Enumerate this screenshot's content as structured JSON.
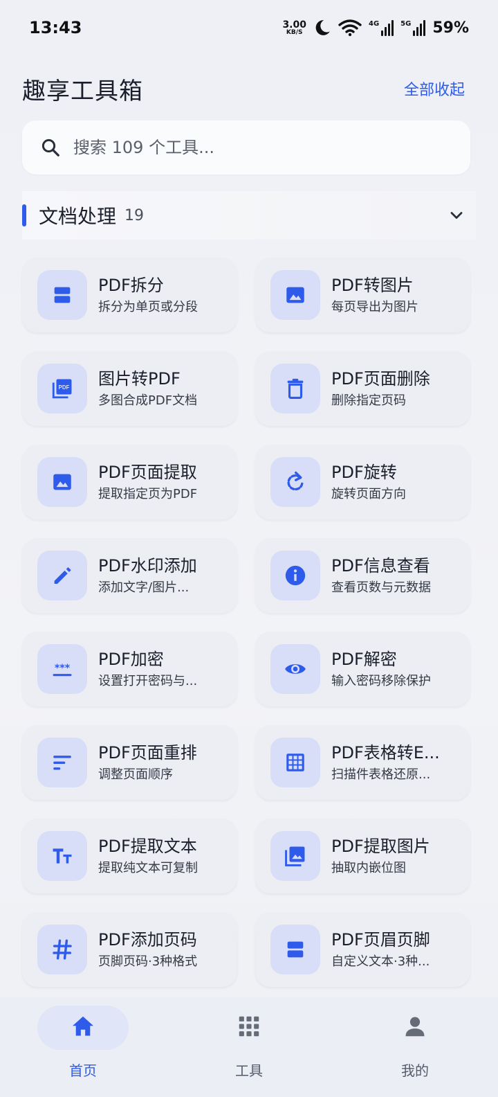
{
  "status_bar": {
    "time": "13:43",
    "speed_value": "3.00",
    "speed_unit": "KB/S",
    "net1": "4G",
    "net2": "5G",
    "battery": "59%"
  },
  "header": {
    "title": "趣享工具箱",
    "collapse_all": "全部收起"
  },
  "search": {
    "placeholder": "搜索 109 个工具..."
  },
  "section": {
    "title": "文档处理",
    "count": "19"
  },
  "colors": {
    "accent": "#2e5bea",
    "icon_bg": "#d8def7",
    "card_bg": "#eceef4"
  },
  "tools": [
    {
      "title": "PDF拆分",
      "subtitle": "拆分为单页或分段",
      "icon": "split-icon"
    },
    {
      "title": "PDF转图片",
      "subtitle": "每页导出为图片",
      "icon": "image-icon"
    },
    {
      "title": "图片转PDF",
      "subtitle": "多图合成PDF文档",
      "icon": "pdf-stack-icon"
    },
    {
      "title": "PDF页面删除",
      "subtitle": "删除指定页码",
      "icon": "trash-icon"
    },
    {
      "title": "PDF页面提取",
      "subtitle": "提取指定页为PDF",
      "icon": "image-icon"
    },
    {
      "title": "PDF旋转",
      "subtitle": "旋转页面方向",
      "icon": "rotate-icon"
    },
    {
      "title": "PDF水印添加",
      "subtitle": "添加文字/图片...",
      "icon": "pencil-icon"
    },
    {
      "title": "PDF信息查看",
      "subtitle": "查看页数与元数据",
      "icon": "info-icon"
    },
    {
      "title": "PDF加密",
      "subtitle": "设置打开密码与...",
      "icon": "password-icon"
    },
    {
      "title": "PDF解密",
      "subtitle": "输入密码移除保护",
      "icon": "eye-icon"
    },
    {
      "title": "PDF页面重排",
      "subtitle": "调整页面顺序",
      "icon": "sort-icon"
    },
    {
      "title": "PDF表格转E...",
      "subtitle": "扫描件表格还原...",
      "icon": "grid-icon"
    },
    {
      "title": "PDF提取文本",
      "subtitle": "提取纯文本可复制",
      "icon": "text-size-icon"
    },
    {
      "title": "PDF提取图片",
      "subtitle": "抽取内嵌位图",
      "icon": "photo-library-icon"
    },
    {
      "title": "PDF添加页码",
      "subtitle": "页脚页码·3种格式",
      "icon": "hash-icon"
    },
    {
      "title": "PDF页眉页脚",
      "subtitle": "自定义文本·3种...",
      "icon": "split-icon"
    }
  ],
  "bottom_nav": [
    {
      "label": "首页",
      "icon": "home-icon",
      "active": true
    },
    {
      "label": "工具",
      "icon": "apps-grid-icon",
      "active": false
    },
    {
      "label": "我的",
      "icon": "person-icon",
      "active": false
    }
  ]
}
